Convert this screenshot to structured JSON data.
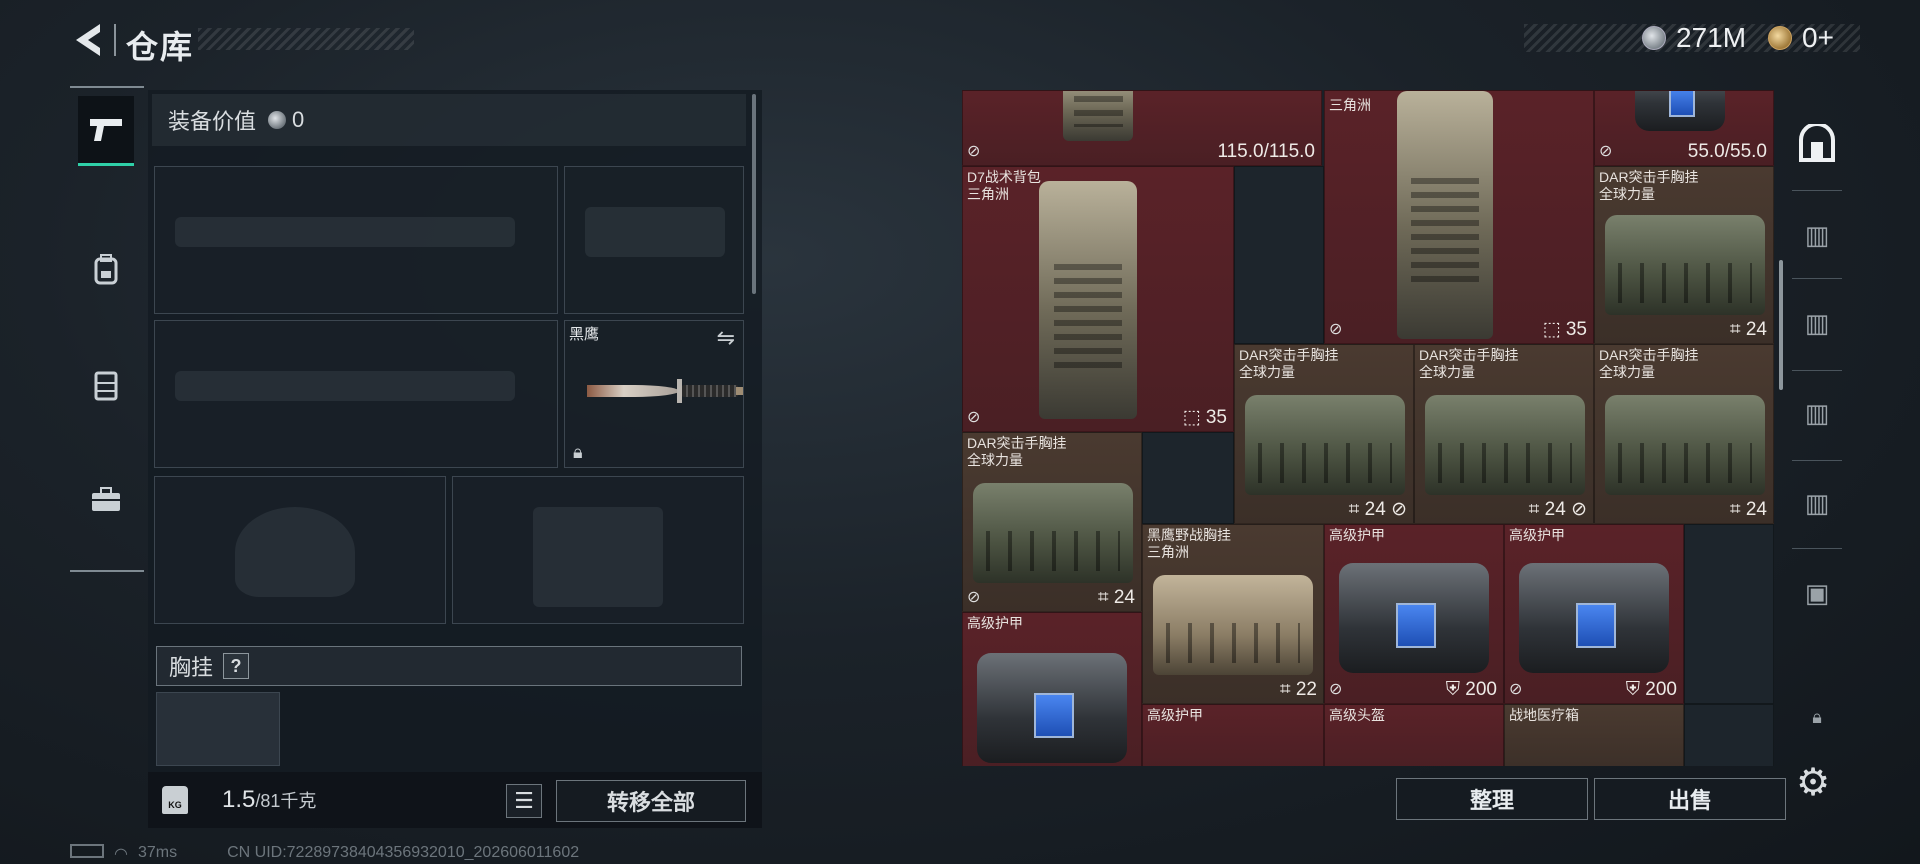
{
  "header": {
    "title": "仓库",
    "silver": "271M",
    "gold": "0+"
  },
  "icons": {
    "back": "back-arrow-icon",
    "tabs": [
      "pistol-icon",
      "backpack-icon",
      "chest-rig-icon",
      "toolbox-icon"
    ],
    "rail": [
      "stash-icon",
      "tier-III-crate-icon",
      "tier-III-crate-icon",
      "tier-III-crate-icon",
      "tier-III-crate-icon",
      "tier-V-crate-icon",
      "lock-icon"
    ]
  },
  "equipment": {
    "value_label": "装备价值",
    "value": "0",
    "knife_label": "黑鹰",
    "rig_title": "胸挂",
    "rig_help": "?",
    "weight_current": "1.5",
    "weight_max": "/81千克",
    "weight_icon_text": "KG",
    "transfer_all": "转移全部"
  },
  "status": {
    "ping": "37ms",
    "uid": "CN UID:7228973840435693​2010_202606011602"
  },
  "stash": {
    "items": [
      {
        "name": "",
        "value": "115.0/115.0"
      },
      {
        "name": "D7战术背包\n三角洲",
        "value": "35"
      },
      {
        "name": "三角洲",
        "value": "35"
      },
      {
        "name": "",
        "value": "55.0/55.0"
      },
      {
        "name": "DAR突击手胸挂\n全球力量",
        "value": "24"
      },
      {
        "name": "DAR突击手胸挂\n全球力量",
        "value": "24"
      },
      {
        "name": "DAR突击手胸挂\n全球力量",
        "value": "24"
      },
      {
        "name": "DAR突击手胸挂\n全球力量",
        "value": "24"
      },
      {
        "name": "DAR突击手胸挂\n全球力量",
        "value": "24"
      },
      {
        "name": "黑鹰野战胸挂\n三角洲",
        "value": "22"
      },
      {
        "name": "高级护甲",
        "value": "200"
      },
      {
        "name": "高级护甲",
        "value": "200"
      },
      {
        "name": "高级护甲",
        "value": ""
      },
      {
        "name": "高级护甲",
        "value": ""
      },
      {
        "name": "高级头盔",
        "value": ""
      },
      {
        "name": "战地医疗箱",
        "value": ""
      }
    ]
  },
  "actions": {
    "sort": "整理",
    "sell": "出售"
  },
  "colors": {
    "accent": "#2fd0a8",
    "item_red": "#5a2228",
    "item_brown": "#4a3a30"
  }
}
